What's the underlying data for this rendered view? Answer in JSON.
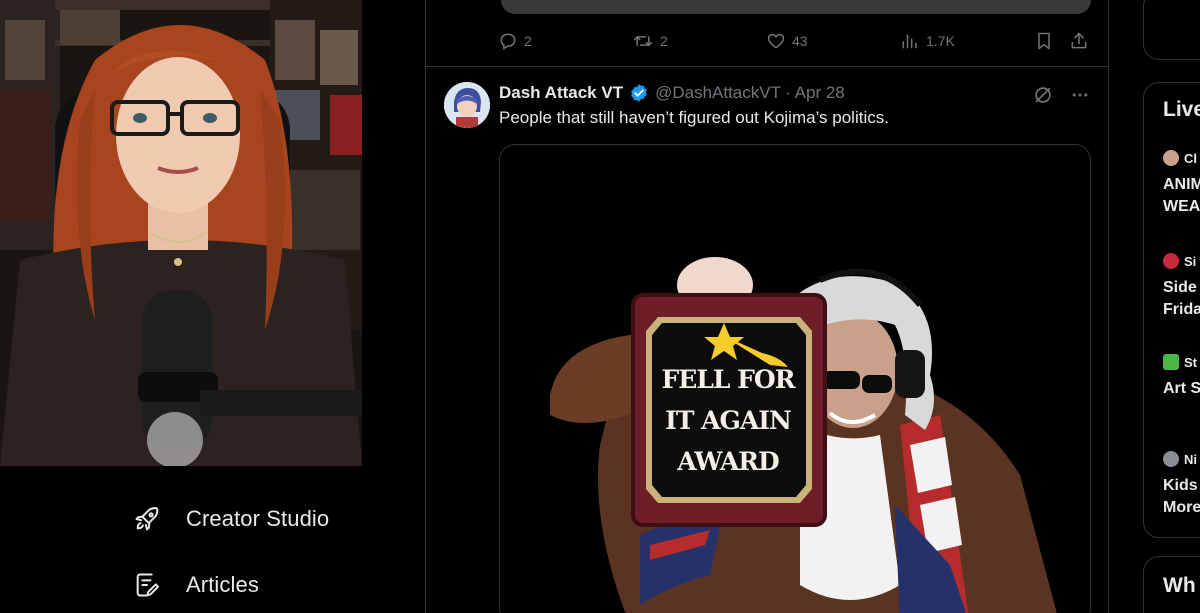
{
  "nav": {
    "creator_studio": "Creator Studio",
    "articles": "Articles"
  },
  "previous_tweet": {
    "replies": "2",
    "reposts": "2",
    "likes": "43",
    "views": "1.7K"
  },
  "tweet": {
    "display_name": "Dash Attack VT",
    "handle": "@DashAttackVT",
    "separator": "·",
    "date": "Apr 28",
    "text": "People that still haven’t figured out Kojima’s politics.",
    "media_caption": [
      "FELL FOR",
      "IT AGAIN",
      "AWARD"
    ]
  },
  "right_sidebar": {
    "live_title": "Live",
    "live_items": [
      {
        "host": "Cl",
        "lines": [
          "ANIM",
          "WEA"
        ]
      },
      {
        "host": "Si",
        "lines": [
          "Side",
          "Frida"
        ]
      },
      {
        "host": "St",
        "lines": [
          "Art S"
        ]
      },
      {
        "host": "Ni",
        "lines": [
          "Kids",
          "More"
        ]
      }
    ],
    "who_title": "Wh"
  },
  "colors": {
    "background": "#000000",
    "border": "#2f3336",
    "muted_text": "#71767b",
    "verified_blue": "#1d9bf0"
  },
  "icons": {
    "creator_studio": "rocket-icon",
    "articles": "articles-icon",
    "reply": "reply-icon",
    "repost": "repost-icon",
    "like": "heart-icon",
    "views": "views-icon",
    "bookmark": "bookmark-icon",
    "share": "share-icon",
    "grok": "grok-icon",
    "more": "more-icon",
    "verified": "verified-badge-icon"
  }
}
